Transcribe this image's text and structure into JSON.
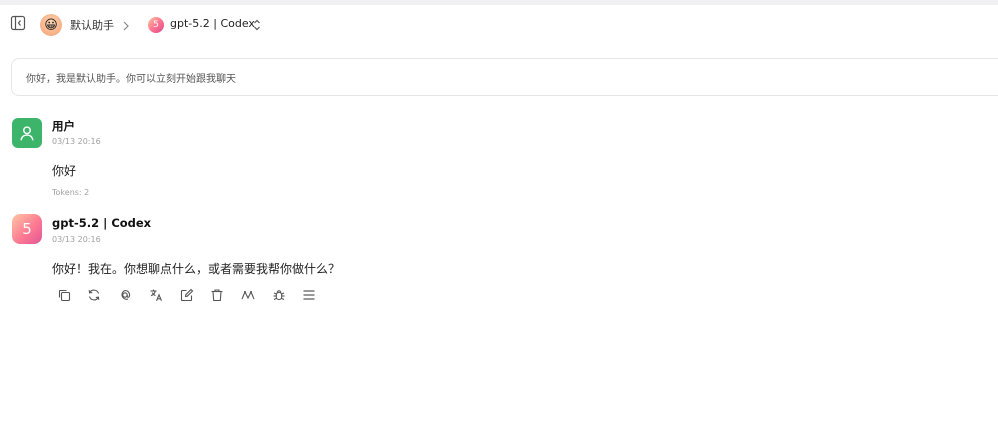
{
  "header": {
    "assistant_name": "默认助手",
    "assistant_avatar_emoji": "😀",
    "model_name": "gpt-5.2 | Codex",
    "model_avatar_glyph": "5"
  },
  "prompt_banner": {
    "text": "你好，我是默认助手。你可以立刻开始跟我聊天"
  },
  "messages": [
    {
      "sender": "用户",
      "time": "03/13 20:16",
      "content": "你好",
      "tokens": "Tokens: 2"
    },
    {
      "sender": "gpt-5.2 | Codex",
      "avatar_glyph": "5",
      "time": "03/13 20:16",
      "content": "你好！我在。你想聊点什么，或者需要我帮你做什么？"
    }
  ],
  "message_actions": [
    "copy-icon",
    "regenerate-icon",
    "mention-icon",
    "translate-icon",
    "edit-icon",
    "delete-icon",
    "trace-icon",
    "debug-icon",
    "menu-icon"
  ],
  "colors": {
    "user_avatar": "#3cb46a",
    "model_gradient_start": "#ffc7a6",
    "model_gradient_end": "#e05598",
    "muted_text": "#a0a0a0",
    "border": "#e6e6e9"
  }
}
